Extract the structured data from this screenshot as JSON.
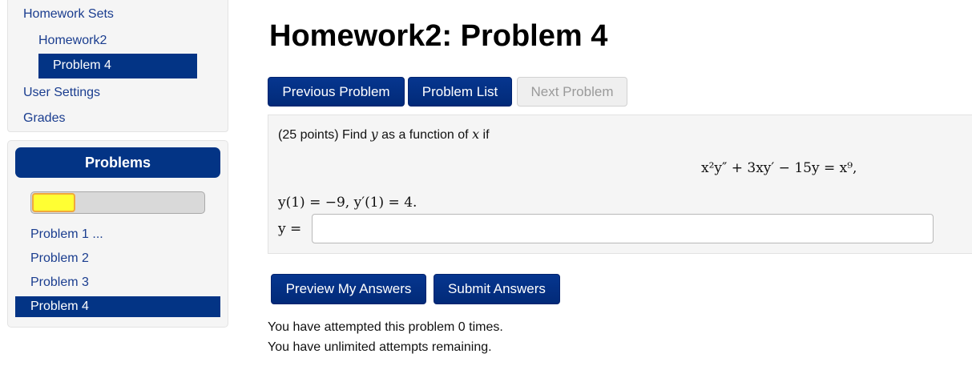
{
  "sidebar": {
    "homework_sets": "Homework Sets",
    "homework2": "Homework2",
    "problem4": "Problem 4",
    "user_settings": "User Settings",
    "grades": "Grades"
  },
  "problems_panel": {
    "title": "Problems",
    "progress_fraction": 0.25,
    "items": [
      "Problem 1 ...",
      "Problem 2",
      "Problem 3",
      "Problem 4"
    ],
    "active_index": 3
  },
  "main": {
    "title": "Homework2: Problem 4",
    "nav_buttons": {
      "previous": "Previous Problem",
      "list": "Problem List",
      "next": "Next Problem"
    },
    "problem": {
      "points": "(25 points) Find ",
      "find_var": "y",
      "as_function": " as a function of ",
      "of_var": "x",
      "if": " if",
      "equation": "x²y″ + 3xy′ − 15y = x⁹,",
      "initial_conditions": "y(1) = −9,  y′(1) = 4.",
      "answer_label": "y =",
      "answer_value": ""
    },
    "submit_buttons": {
      "preview": "Preview My Answers",
      "submit": "Submit Answers"
    },
    "messages": {
      "attempted": "You have attempted this problem 0 times.",
      "remaining": "You have unlimited attempts remaining."
    }
  },
  "colors": {
    "primary": "#033485",
    "link": "#1a3d8f",
    "progress_fill": "#ffff33",
    "panel_bg": "#f5f5f5"
  }
}
